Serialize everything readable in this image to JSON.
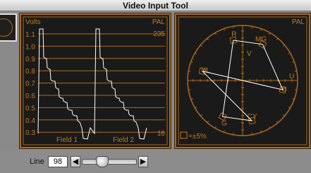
{
  "window": {
    "title": "Video Input Tool"
  },
  "waveform": {
    "unit_label": "Volts",
    "standard": "PAL",
    "y_ticks": [
      "1.1",
      "1.0",
      "0.9",
      "0.8",
      "0.7",
      "0.6",
      "0.5",
      "0.4",
      "0.3"
    ],
    "top_value": "235",
    "bottom_value": "16",
    "field1_label": "Field 1",
    "field2_label": "Field 2"
  },
  "vectorscope": {
    "standard": "PAL",
    "targets": [
      {
        "label": "R",
        "angle_deg": 103
      },
      {
        "label": "MG",
        "angle_deg": 61
      },
      {
        "label": "B",
        "angle_deg": 347
      },
      {
        "label": "CY",
        "angle_deg": 283
      },
      {
        "label": "G",
        "angle_deg": 241
      },
      {
        "label": "YL",
        "angle_deg": 167
      }
    ],
    "axis_labels": {
      "v": "V",
      "u": "U"
    },
    "tolerance_label": "=±5%"
  },
  "line_control": {
    "label": "Line",
    "value": "98",
    "slider_level": 0.34,
    "decrement_icon": "arrow-left-icon",
    "increment_icon": "arrow-right-icon"
  },
  "colors": {
    "panel_border": "#a46a22",
    "grid": "#b06a18",
    "label": "#c07a22",
    "trace": "#ffffff"
  }
}
